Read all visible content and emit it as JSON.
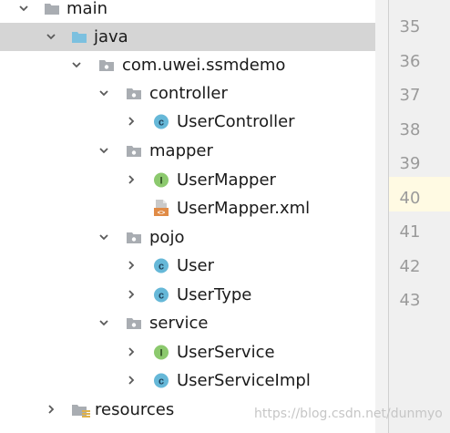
{
  "colors": {
    "folder_gray": "#a9adb2",
    "folder_blue": "#7cc0df",
    "class_circle": "#66b8d8",
    "interface_circle": "#8cc96e",
    "xml_orange": "#e08b46",
    "selection": "#d5d5d5",
    "current_line": "#fffae3"
  },
  "tree": {
    "main": "main",
    "java": "java",
    "package": "com.uwei.ssmdemo",
    "controller": "controller",
    "user_controller": "UserController",
    "mapper": "mapper",
    "user_mapper": "UserMapper",
    "user_mapper_xml": "UserMapper.xml",
    "pojo": "pojo",
    "user": "User",
    "user_type": "UserType",
    "service": "service",
    "user_service": "UserService",
    "user_service_impl": "UserServiceImpl",
    "resources": "resources"
  },
  "icons": {
    "class": "class-icon",
    "interface": "interface-icon",
    "xml": "xml-file-icon",
    "folder": "folder-icon",
    "source_folder": "source-folder-icon",
    "package": "package-icon"
  },
  "gutter": {
    "lines": [
      "35",
      "36",
      "37",
      "38",
      "39",
      "40",
      "41",
      "42",
      "43"
    ]
  },
  "watermark": "https://blog.csdn.net/dunmyo"
}
